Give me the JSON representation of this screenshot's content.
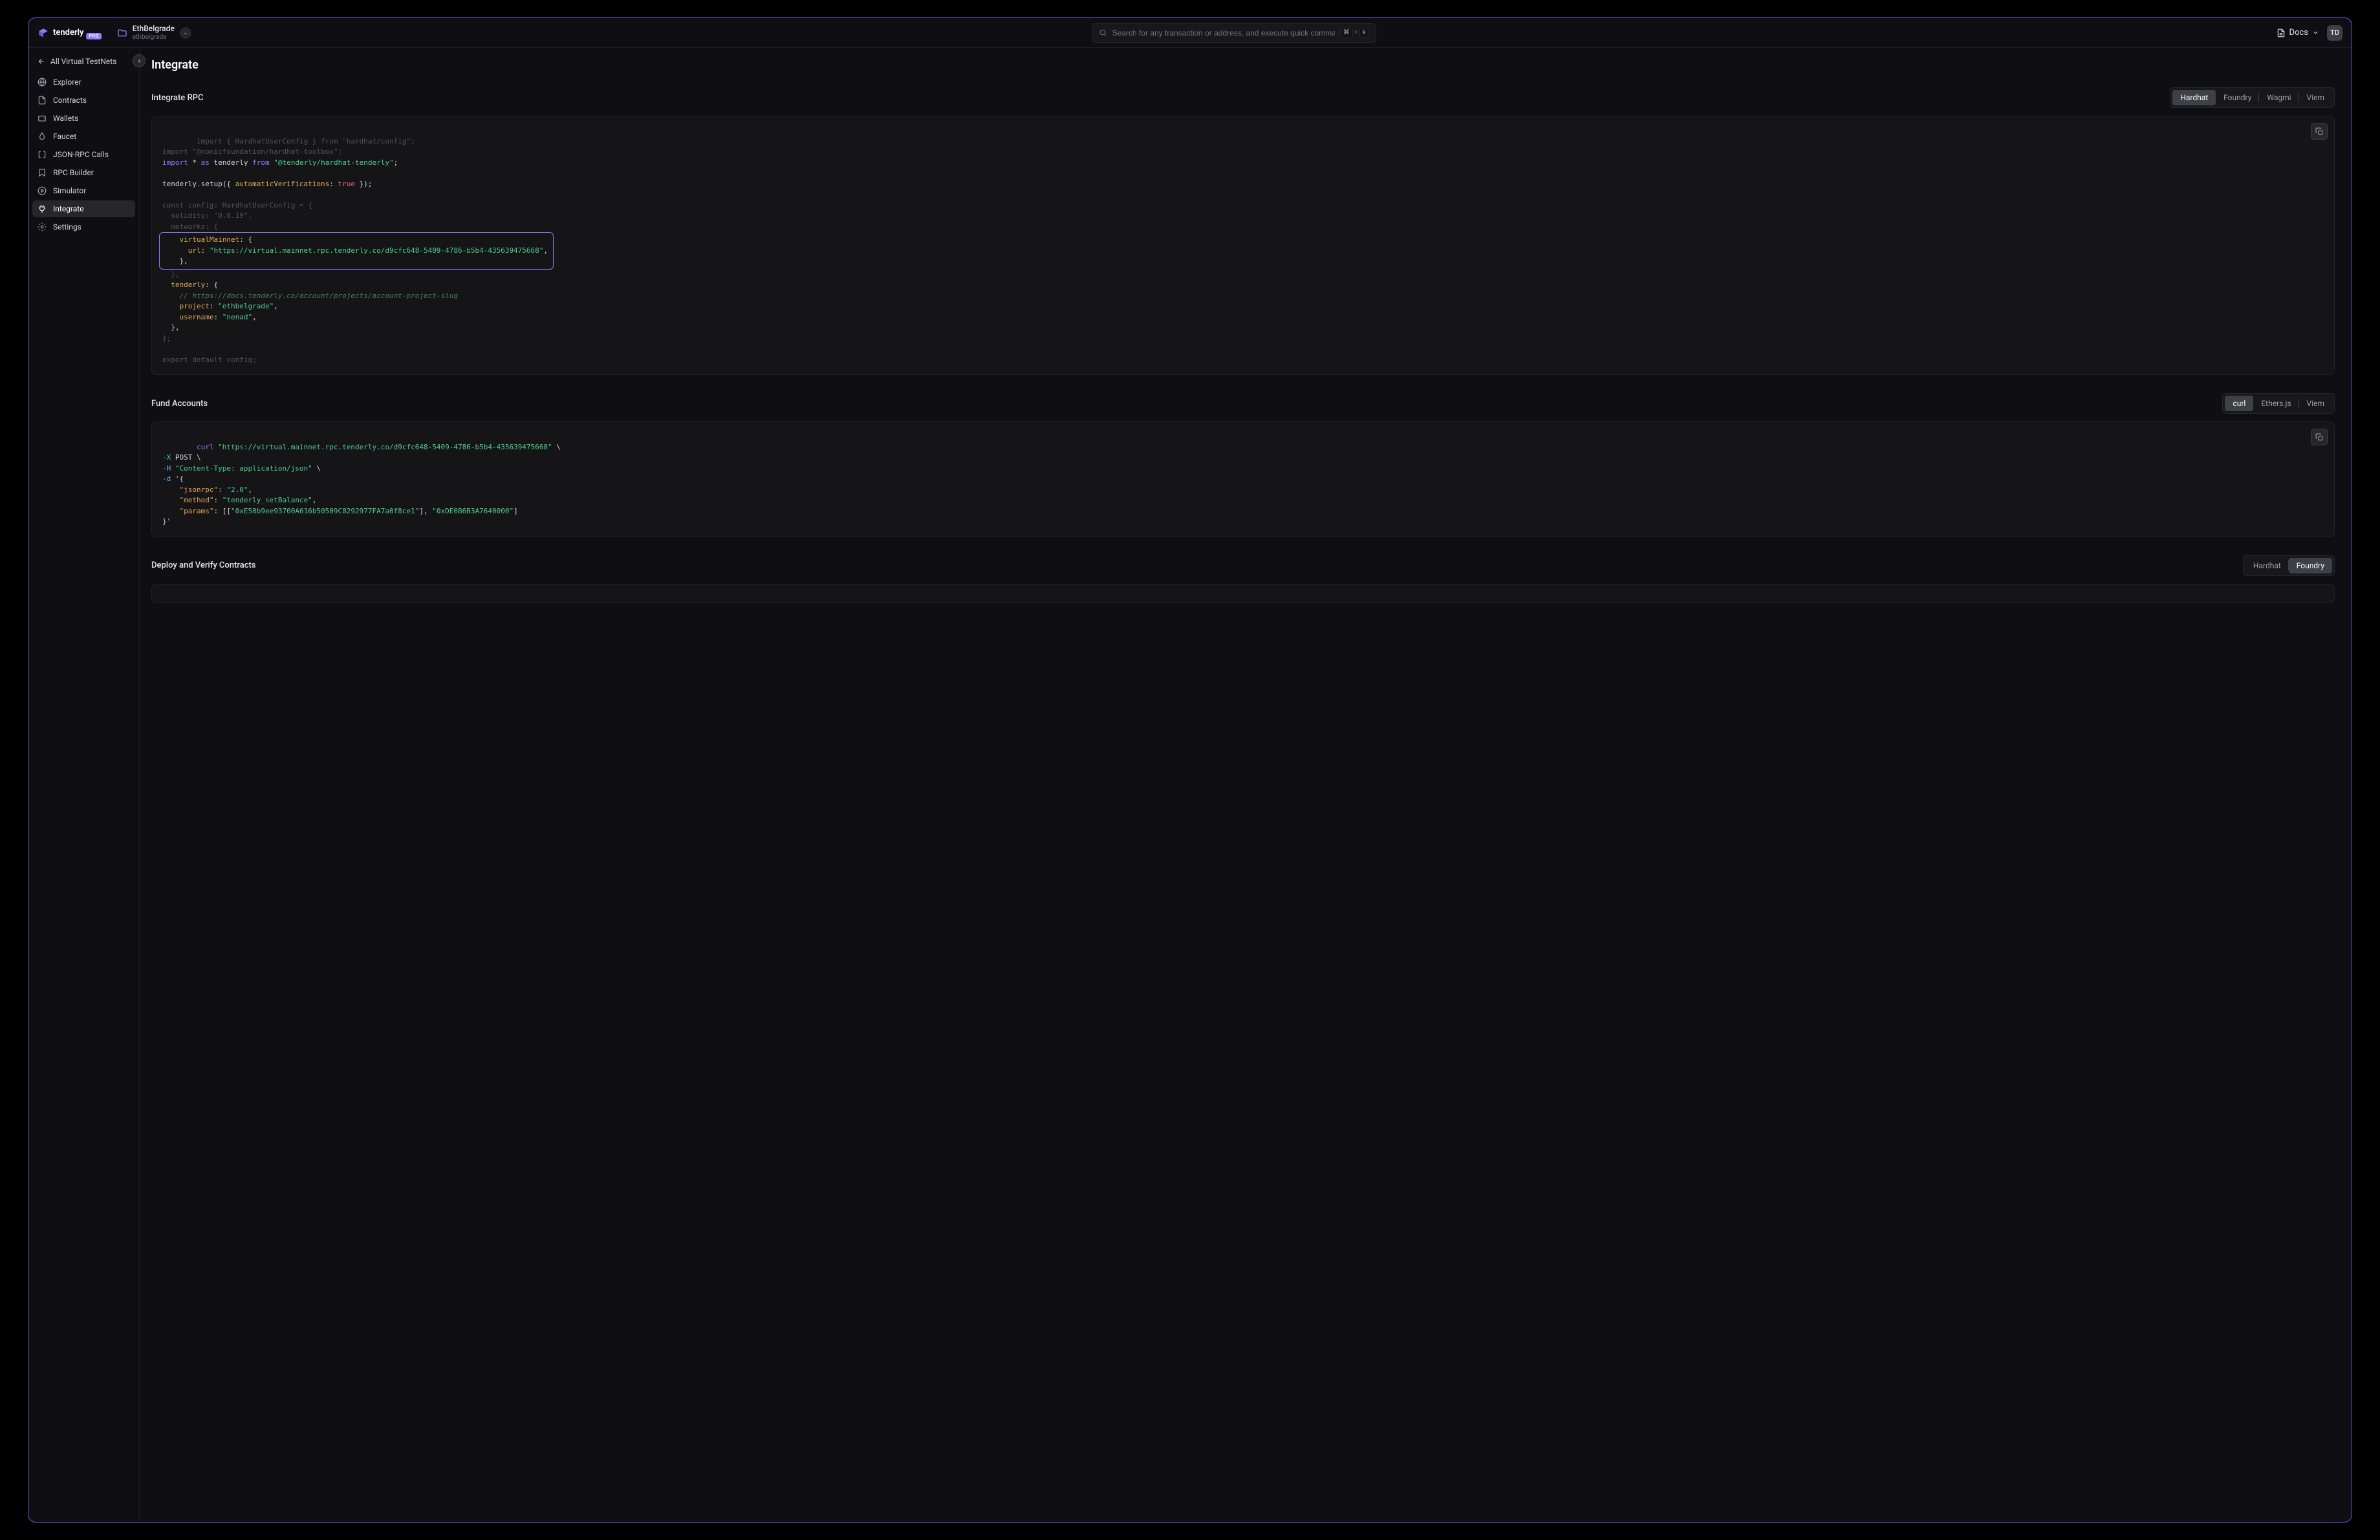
{
  "brand": {
    "name": "tenderly",
    "badge": "PRO"
  },
  "project": {
    "name": "EthBelgrade",
    "slug": "ethbelgrade"
  },
  "search": {
    "placeholder": "Search for any transaction or address, and execute quick commands",
    "kbd1": "⌘",
    "kbd_plus": "+",
    "kbd2": "k"
  },
  "header": {
    "docs": "Docs",
    "avatar": "TD"
  },
  "sidebar": {
    "back": "All Virtual TestNets",
    "items": [
      {
        "label": "Explorer"
      },
      {
        "label": "Contracts"
      },
      {
        "label": "Wallets"
      },
      {
        "label": "Faucet"
      },
      {
        "label": "JSON-RPC Calls"
      },
      {
        "label": "RPC Builder"
      },
      {
        "label": "Simulator"
      },
      {
        "label": "Integrate"
      },
      {
        "label": "Settings"
      }
    ]
  },
  "page": {
    "title": "Integrate"
  },
  "rpc_section": {
    "title": "Integrate RPC",
    "tabs": [
      "Hardhat",
      "Foundry",
      "Wagmi",
      "Viem"
    ],
    "code": {
      "l1a": "import",
      "l1b": " { HardhatUserConfig } ",
      "l1c": "from",
      "l1d": " \"hardhat/config\";",
      "l2a": "import",
      "l2b": " \"@nomicfoundation/hardhat-toolbox\";",
      "l3a": "import",
      "l3b": " * ",
      "l3c": "as",
      "l3d": " tenderly ",
      "l3e": "from",
      "l3f": " \"@tenderly/hardhat-tenderly\"",
      "l3g": ";",
      "l5a": "tenderly.setup({ ",
      "l5b": "automaticVerifications",
      "l5c": ": ",
      "l5d": "true",
      "l5e": " });",
      "l7a": "const",
      "l7b": " config: HardhatUserConfig = {",
      "l8a": "  solidity: ",
      "l8b": "\"0.8.19\"",
      "l8c": ",",
      "l9a": "  networks: {",
      "l10a": "    virtualMainnet",
      "l10b": ": {",
      "l11a": "      url",
      "l11b": ": ",
      "l11c": "\"https://virtual.mainnet.rpc.tenderly.co/d9cfc648-5409-4786-b5b4-435639475668\"",
      "l11d": ",",
      "l12a": "    },",
      "l13a": "  },",
      "l14a": "  tenderly",
      "l14b": ": {",
      "l15a": "    // https://docs.tenderly.co/account/projects/account-project-slug",
      "l16a": "    project",
      "l16b": ": ",
      "l16c": "\"ethbelgrade\"",
      "l16d": ",",
      "l17a": "    username",
      "l17b": ": ",
      "l17c": "\"nenad\"",
      "l17d": ",",
      "l18a": "  },",
      "l19a": "};",
      "l21a": "export default",
      "l21b": " config;"
    }
  },
  "fund_section": {
    "title": "Fund Accounts",
    "tabs": [
      "curl",
      "Ethers.js",
      "Viem"
    ],
    "code": {
      "l1a": "curl",
      "l1b": " ",
      "l1c": "\"https://virtual.mainnet.rpc.tenderly.co/d9cfc648-5409-4786-b5b4-435639475668\"",
      "l1d": " \\",
      "l2a": "-X",
      "l2b": " POST \\",
      "l3a": "-H",
      "l3b": " ",
      "l3c": "\"Content-Type: application/json\"",
      "l3d": " \\",
      "l4a": "-d",
      "l4b": " '{",
      "l5a": "    \"jsonrpc\"",
      "l5b": ": ",
      "l5c": "\"2.0\"",
      "l5d": ",",
      "l6a": "    \"method\"",
      "l6b": ": ",
      "l6c": "\"tenderly_setBalance\"",
      "l6d": ",",
      "l7a": "    \"params\"",
      "l7b": ": [[",
      "l7c": "\"0xE58b9ee93700A616b50509C8292977FA7a0f8ce1\"",
      "l7d": "], ",
      "l7e": "\"0xDE0B6B3A7640000\"",
      "l7f": "]",
      "l8a": "}'"
    }
  },
  "deploy_section": {
    "title": "Deploy and Verify Contracts",
    "tabs": [
      "Hardhat",
      "Foundry"
    ]
  }
}
